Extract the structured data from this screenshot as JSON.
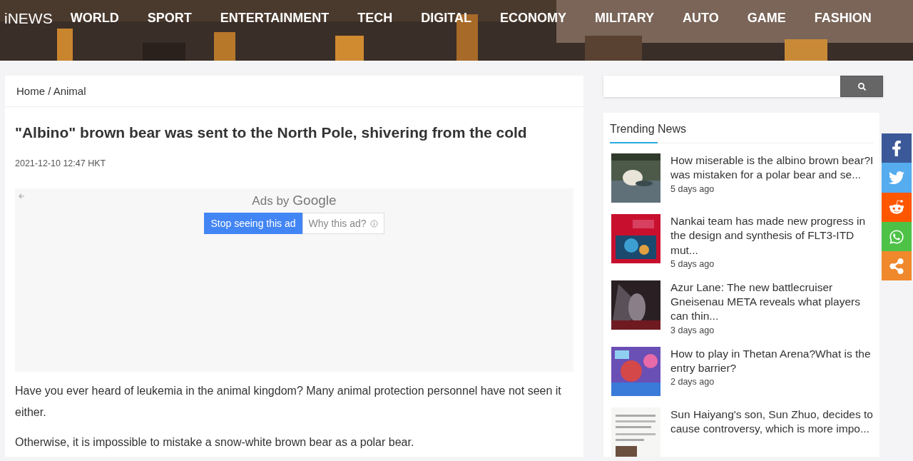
{
  "header": {
    "logo": "iNEWS",
    "nav": [
      {
        "label": "WORLD"
      },
      {
        "label": "SPORT"
      },
      {
        "label": "ENTERTAINMENT"
      },
      {
        "label": "TECH"
      },
      {
        "label": "DIGITAL"
      },
      {
        "label": "ECONOMY"
      },
      {
        "label": "MILITARY"
      },
      {
        "label": "AUTO"
      },
      {
        "label": "GAME"
      },
      {
        "label": "FASHION"
      }
    ]
  },
  "breadcrumb": "Home / Animal",
  "article": {
    "title": "\"Albino\" brown bear was sent to the North Pole, shivering from the cold",
    "date": "2021-12-10 12:47 HKT",
    "ad": {
      "ads_by": "Ads by",
      "brand": "Google",
      "stop_button": "Stop seeing this ad",
      "why_button": "Why this ad?"
    },
    "paragraphs": [
      "Have you ever heard of leukemia in the animal kingdom? Many animal protection personnel have not seen it either.",
      "Otherwise, it is impossible to mistake a snow-white brown bear as a polar bear."
    ]
  },
  "sidebar": {
    "trending_title": "Trending News",
    "items": [
      {
        "title": "How miserable is the albino brown bear?I was mistaken for a polar bear and se...",
        "time": "5 days ago",
        "kind": "picture"
      },
      {
        "title": "Nankai team has made new progress in the design and synthesis of FLT3-ITD mut...",
        "time": "5 days ago",
        "kind": "picture"
      },
      {
        "title": "Azur Lane: The new battlecruiser Gneisenau META reveals what players can thin...",
        "time": "3 days ago",
        "kind": "picture"
      },
      {
        "title": "How to play in Thetan Arena?What is the entry barrier?",
        "time": "2 days ago",
        "kind": "picture"
      },
      {
        "title": "Sun Haiyang's son, Sun Zhuo, decides to cause controversy, which is more impo...",
        "kind": "picture"
      }
    ]
  },
  "share": [
    {
      "kind": "facebook",
      "color": "#3b5998"
    },
    {
      "kind": "twitter",
      "color": "#55acee"
    },
    {
      "kind": "reddit",
      "color": "#ff5700"
    },
    {
      "kind": "whatsapp",
      "color": "#4dc247"
    },
    {
      "kind": "share",
      "color": "#f0882c"
    }
  ]
}
